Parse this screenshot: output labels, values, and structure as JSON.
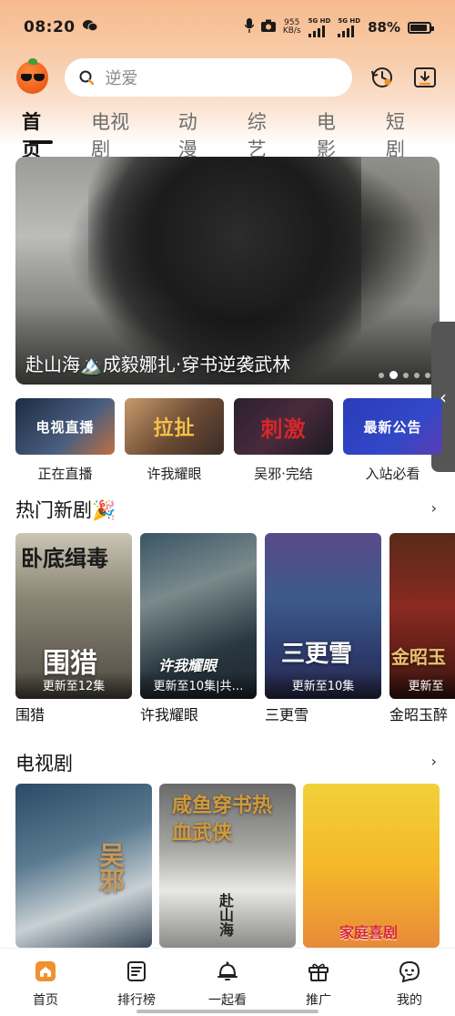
{
  "status_bar": {
    "time": "08:20",
    "net_speed_value": "955",
    "net_speed_unit": "KB/s",
    "sim1_label": "5G HD",
    "sim2_label": "5G HD",
    "battery": "88%",
    "battery_level": 0.88
  },
  "header": {
    "search_placeholder": "逆爱"
  },
  "tabs": [
    {
      "label": "首页",
      "active": true
    },
    {
      "label": "电视剧"
    },
    {
      "label": "动漫"
    },
    {
      "label": "综艺"
    },
    {
      "label": "电影"
    },
    {
      "label": "短剧"
    }
  ],
  "banner": {
    "title": "赴山海🏔️成毅娜扎·穿书逆袭武林",
    "dot_count": 5,
    "active_dot": 2
  },
  "quick_entries": [
    {
      "label": "正在直播",
      "image_text": "电视直播",
      "color": "#2c3e5a"
    },
    {
      "label": "许我耀眼",
      "image_text": "拉扯",
      "color": "#7a5a3a"
    },
    {
      "label": "吴邪·完结",
      "image_text": "刺激",
      "color": "#3a2a3a"
    },
    {
      "label": "入站必看",
      "image_text": "最新公告",
      "color": "#2a3aa8"
    }
  ],
  "hot_section": {
    "title": "热门新剧🎉",
    "more": "›",
    "items": [
      {
        "title": "围猎",
        "badge": "更新至12集",
        "poster_text": "卧底缉毒",
        "poster_text2": "围猎"
      },
      {
        "title": "许我耀眼",
        "badge": "更新至10集|共…",
        "poster_text": "许我耀眼"
      },
      {
        "title": "三更雪",
        "badge": "更新至10集",
        "poster_text": "三更雪"
      },
      {
        "title": "金昭玉醉",
        "badge": "更新至",
        "poster_text": "金昭玉"
      }
    ]
  },
  "tv_section": {
    "title": "电视剧",
    "more": "›",
    "items": [
      {
        "poster_text": "吴邪"
      },
      {
        "poster_text": "咸鱼穿书热血武侠",
        "poster_text2": "赴山海"
      },
      {
        "poster_text": "家庭喜剧"
      }
    ]
  },
  "bottom_nav": [
    {
      "label": "首页",
      "icon": "home-icon",
      "active": true
    },
    {
      "label": "排行榜",
      "icon": "ranking-icon"
    },
    {
      "label": "一起看",
      "icon": "watch-together-icon"
    },
    {
      "label": "推广",
      "icon": "gift-icon"
    },
    {
      "label": "我的",
      "icon": "profile-icon"
    }
  ],
  "colors": {
    "accent": "#f0902f",
    "header_bg_top": "#f7b98c"
  }
}
